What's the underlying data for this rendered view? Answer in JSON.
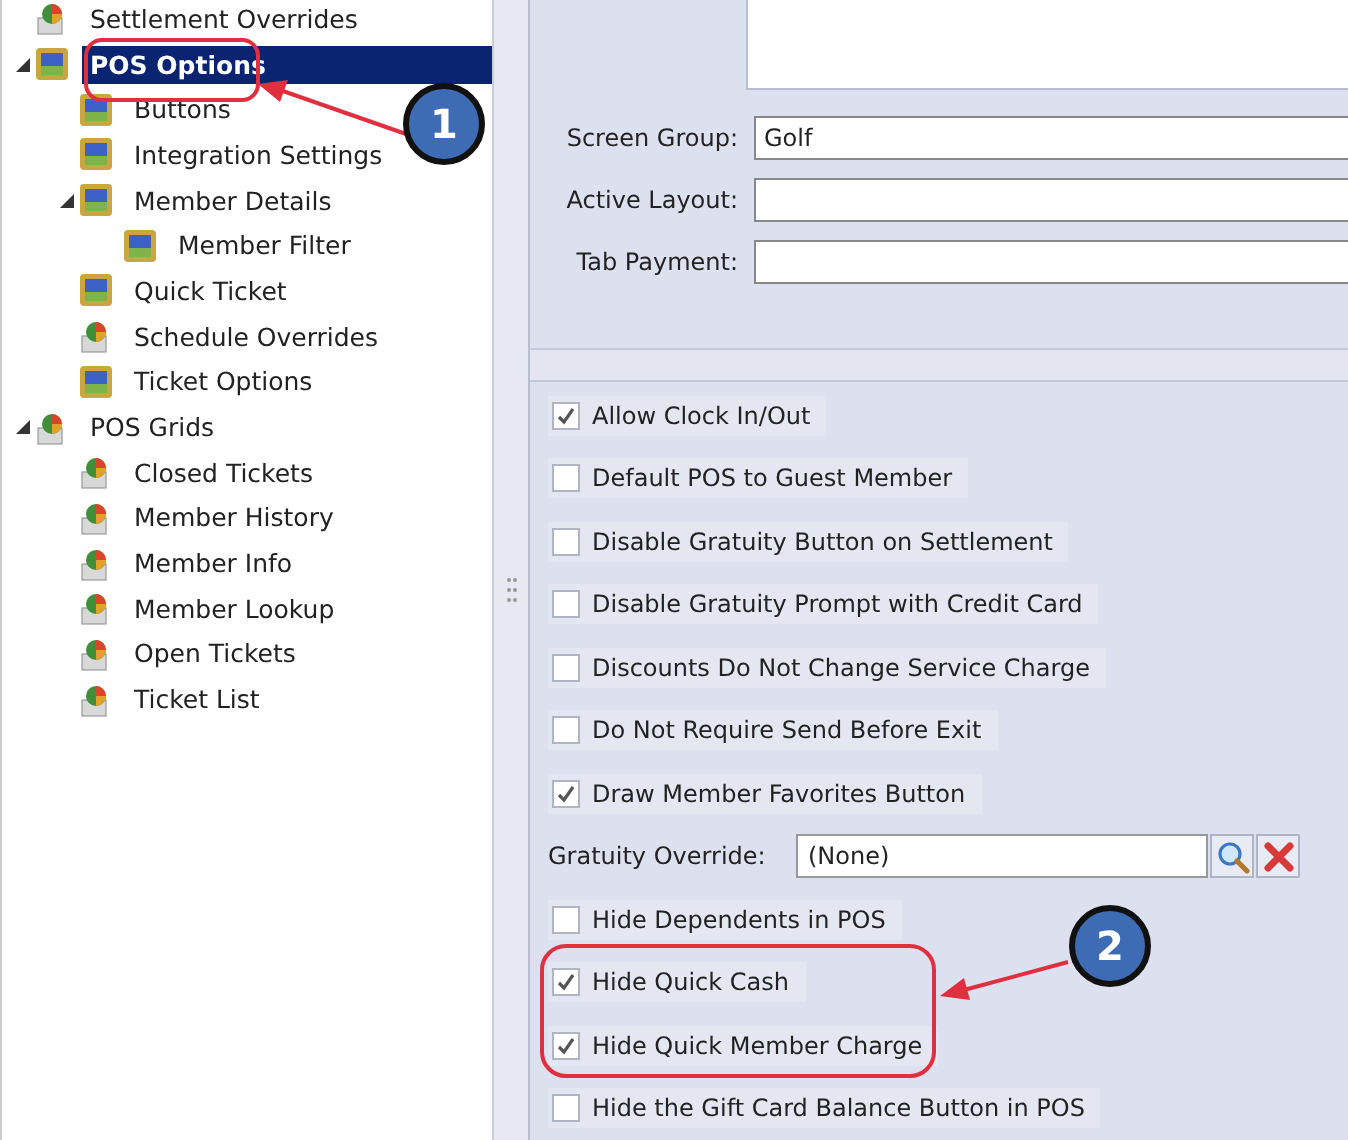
{
  "tree": [
    {
      "label": "Settlement Overrides",
      "kind": "grid",
      "selected": false
    },
    {
      "label": "POS Options",
      "kind": "options",
      "selected": true,
      "expanded": true,
      "children": [
        {
          "label": "Buttons",
          "kind": "options",
          "selected": false
        },
        {
          "label": "Integration Settings",
          "kind": "options",
          "selected": false
        },
        {
          "label": "Member Details",
          "kind": "options",
          "selected": false,
          "expanded": true,
          "children": [
            {
              "label": "Member Filter",
              "kind": "options",
              "selected": false
            }
          ]
        },
        {
          "label": "Quick Ticket",
          "kind": "options",
          "selected": false
        },
        {
          "label": "Schedule Overrides",
          "kind": "grid",
          "selected": false
        },
        {
          "label": "Ticket Options",
          "kind": "options",
          "selected": false
        }
      ]
    },
    {
      "label": "POS Grids",
      "kind": "grid",
      "selected": false,
      "expanded": true,
      "children": [
        {
          "label": "Closed Tickets",
          "kind": "grid",
          "selected": false
        },
        {
          "label": "Member History",
          "kind": "grid",
          "selected": false
        },
        {
          "label": "Member Info",
          "kind": "grid",
          "selected": false
        },
        {
          "label": "Member Lookup",
          "kind": "grid",
          "selected": false
        },
        {
          "label": "Open Tickets",
          "kind": "grid",
          "selected": false
        },
        {
          "label": "Ticket List",
          "kind": "grid",
          "selected": false
        }
      ]
    }
  ],
  "fields": [
    {
      "label": "Screen Group:",
      "value": "Golf"
    },
    {
      "label": "Active Layout:"
    },
    {
      "label": "Tab Payment:"
    }
  ],
  "settings": [
    {
      "kind": "checkbox",
      "label": "Allow Clock In/Out",
      "checked": true
    },
    {
      "kind": "checkbox",
      "label": "Default POS to Guest Member",
      "checked": false
    },
    {
      "kind": "checkbox",
      "label": "Disable Gratuity Button on Settlement",
      "checked": false
    },
    {
      "kind": "checkbox",
      "label": "Disable Gratuity Prompt with Credit Card",
      "checked": false
    },
    {
      "kind": "checkbox",
      "label": "Discounts Do Not Change Service Charge",
      "checked": false
    },
    {
      "kind": "checkbox",
      "label": "Do Not Require Send Before Exit",
      "checked": false
    },
    {
      "kind": "checkbox",
      "label": "Draw Member Favorites Button",
      "checked": true
    },
    {
      "kind": "lookup",
      "label": "Gratuity Override:",
      "value": "(None)"
    },
    {
      "kind": "checkbox",
      "label": "Hide Dependents in POS",
      "checked": false
    },
    {
      "kind": "checkbox",
      "label": "Hide Quick Cash",
      "checked": true
    },
    {
      "kind": "checkbox",
      "label": "Hide Quick Member Charge",
      "checked": true
    },
    {
      "kind": "checkbox",
      "label": "Hide the Gift Card Balance Button in POS",
      "checked": false
    }
  ],
  "annotations": [
    {
      "number": "1"
    },
    {
      "number": "2"
    }
  ]
}
